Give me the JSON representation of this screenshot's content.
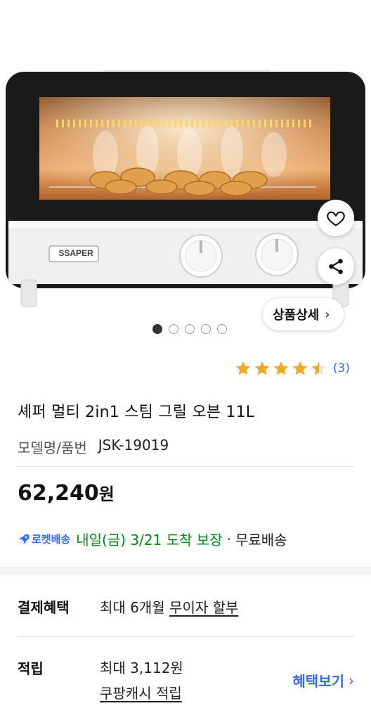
{
  "image": {
    "brand_label": "SSAPER",
    "detail_button": "상품상세",
    "carousel_count": 5,
    "carousel_active_index": 0
  },
  "actions": {
    "heart_icon": "heart-icon",
    "share_icon": "share-icon"
  },
  "rating": {
    "stars": 4.5,
    "count_text": "(3)"
  },
  "product": {
    "title": "셰퍼 멀티 2in1 스팀 그릴 오븐 11L",
    "model_label": "모델명/품번",
    "model_value": "JSK-19019",
    "price_number": "62,240",
    "price_unit": "원"
  },
  "delivery": {
    "badge": "로켓배송",
    "arrival": "내일(금) 3/21 도착 보장",
    "separator": "·",
    "shipping": "무료배송"
  },
  "benefits": {
    "label": "결제혜택",
    "prefix": "최대 6개월",
    "link": "무이자 할부"
  },
  "points": {
    "label": "적립",
    "line1": "최대 3,112원",
    "line2": "쿠팡캐시 적립",
    "see_button": "혜택보기"
  },
  "colors": {
    "link_blue": "#346aff",
    "arrival_green": "#00891a",
    "star": "#f5a623"
  }
}
